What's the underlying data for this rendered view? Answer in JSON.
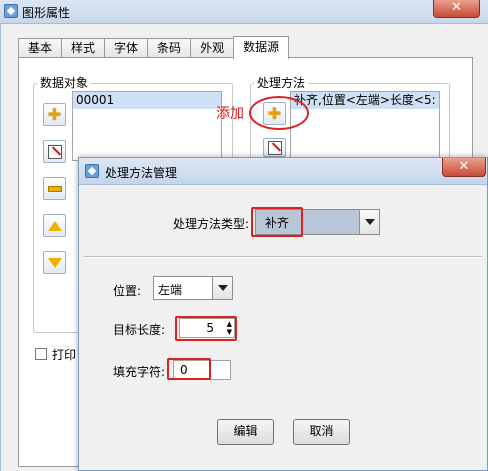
{
  "outer": {
    "title": "图形属性",
    "close": "✕",
    "tabs": [
      "基本",
      "样式",
      "字体",
      "条码",
      "外观",
      "数据源"
    ],
    "data_object_label": "数据对象",
    "data_object_items": [
      "00001"
    ],
    "processing_label": "处理方法",
    "processing_items": [
      "补齐,位置<左端>长度<5:"
    ],
    "add_annotation": "添加",
    "print_checkbox_label": "打印"
  },
  "dialog": {
    "title": "处理方法管理",
    "close": "✕",
    "method_type_label": "处理方法类型:",
    "method_type_value": "补齐",
    "position_label": "位置:",
    "position_value": "左端",
    "target_length_label": "目标长度:",
    "target_length_value": "5",
    "fill_char_label": "填充字符:",
    "fill_char_value": "0",
    "edit_button": "编辑",
    "cancel_button": "取消"
  },
  "colors": {
    "annotation_red": "#e02020",
    "selection_blue": "#cde0f4",
    "close_red": "#c74c35"
  }
}
